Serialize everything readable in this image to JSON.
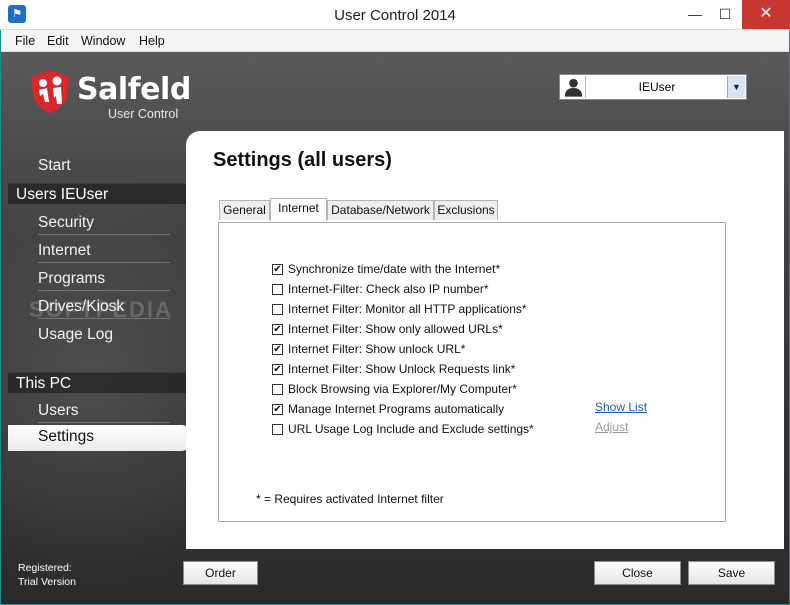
{
  "window": {
    "title": "User Control 2014",
    "min": "—",
    "max": "☐",
    "close": "✕"
  },
  "menu": [
    "File",
    "Edit",
    "Window",
    "Help"
  ],
  "brand": {
    "name": "Salfeld",
    "subtitle": "User Control",
    "watermark": "SOFTPEDIA"
  },
  "user_selector": {
    "value": "IEUser",
    "dropdown_glyph": "▼"
  },
  "nav": {
    "start": "Start",
    "users_header": "Users IEUser",
    "security": "Security",
    "internet": "Internet",
    "programs": "Programs",
    "drives": "Drives/Kiosk",
    "usage_log": "Usage Log",
    "pc_header": "This PC",
    "users": "Users",
    "settings": "Settings"
  },
  "registered": {
    "line1": "Registered:",
    "line2": "Trial Version"
  },
  "panel": {
    "title": "Settings (all users)",
    "tabs": [
      "General",
      "Internet",
      "Database/Network",
      "Exclusions"
    ],
    "active_tab": "Internet",
    "options": [
      {
        "label": "Synchronize time/date with the Internet*",
        "checked": true
      },
      {
        "label": "Internet-Filter: Check also IP number*",
        "checked": false
      },
      {
        "label": "Internet Filter: Monitor all HTTP applications*",
        "checked": false
      },
      {
        "label": "Internet Filter: Show only allowed URLs*",
        "checked": true
      },
      {
        "label": "Internet Filter: Show unlock URL*",
        "checked": true
      },
      {
        "label": "Internet Filter: Show Unlock Requests link*",
        "checked": true
      },
      {
        "label": "Block Browsing via Explorer/My Computer*",
        "checked": false
      },
      {
        "label": "Manage Internet Programs automatically",
        "checked": true
      },
      {
        "label": "URL Usage Log Include and Exclude settings*",
        "checked": false
      }
    ],
    "links": {
      "show_list": "Show List",
      "adjust": "Adjust"
    },
    "footnote": "* = Requires activated Internet filter"
  },
  "buttons": {
    "order": "Order",
    "close": "Close",
    "save": "Save"
  },
  "colors": {
    "accent_link": "#1a5fb4",
    "close_button": "#c7372f",
    "brand_red": "#d9272e"
  }
}
